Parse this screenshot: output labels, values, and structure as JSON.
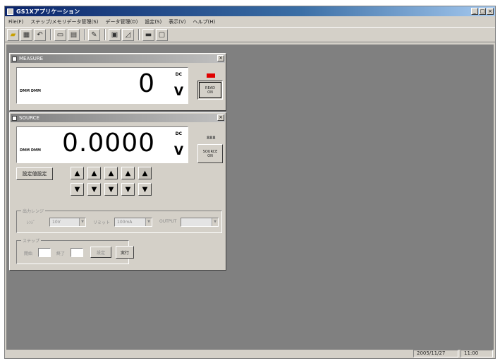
{
  "window": {
    "title": "GS1Xアプリケーション",
    "controls": [
      "_",
      "□",
      "×"
    ]
  },
  "menu": [
    "File(F)",
    "ステップ/メモリデータ管理(S)",
    "データ管理(D)",
    "設定(S)",
    "表示(V)",
    "ヘルプ(H)"
  ],
  "toolbar": {
    "icons": [
      "open-folder-icon",
      "save-icon",
      "undo-icon",
      "document-icon",
      "list-icon",
      "settings-icon",
      "meter-icon",
      "graph-icon",
      "window-icon",
      "panel-icon"
    ]
  },
  "measure_window": {
    "title": "MEASURE",
    "close": "×",
    "mode_label": "DMM DMM",
    "value": "0",
    "dc": "DC",
    "unit": "V",
    "button": "READ\nON",
    "led_color": "#e00000"
  },
  "source_window": {
    "title": "SOURCE",
    "close": "×",
    "mode_label": "DMM DMM",
    "value": "0.0000",
    "dc": "DC",
    "unit": "V",
    "led_label": "888",
    "button": "SOURCE\nON",
    "preset_button": "設定値設定",
    "up_arrows": [
      "▲",
      "▲",
      "▲",
      "▲",
      "▲"
    ],
    "down_arrows": [
      "▼",
      "▼",
      "▼",
      "▼",
      "▼"
    ],
    "range_group": {
      "title": "出力レンジ",
      "label1": "ﾚﾝｼﾞ",
      "value1": "10V",
      "label2": "リミット",
      "value2": "100mA",
      "label3": "OUTPUT",
      "value3": ""
    },
    "sweep_group": {
      "title": "ステップ",
      "label1": "開始",
      "label2": "終了",
      "set_button": "設定",
      "run_button": "実行"
    }
  },
  "status": {
    "date": "2005/11/27",
    "time": "11:00"
  }
}
